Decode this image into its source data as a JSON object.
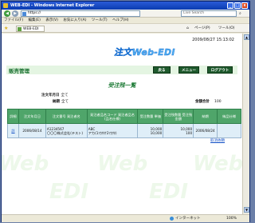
{
  "window": {
    "title": "WEB-EDI - Windows Internet Explorer",
    "minimize": "_",
    "maximize": "□",
    "close": "x"
  },
  "browser": {
    "back": "◀",
    "forward": "▶",
    "address": "https://",
    "search_placeholder": "Live Search",
    "menu": [
      "ファイル(F)",
      "編集(E)",
      "表示(V)",
      "お気に入り(A)",
      "ツール(T)",
      "ヘルプ(H)"
    ],
    "tab_title": "WEB-EDI",
    "toolbar": {
      "home": "⌂",
      "page": "ページ(P)",
      "tools": "ツール(O)"
    },
    "status_zone": "インターネット",
    "zoom": "100%"
  },
  "page": {
    "datetime": "2009/08/27 15:13:02",
    "logo": "注文Web-EDI",
    "watermark": "Web",
    "watermark2": "EDI",
    "system_title": "販売管理",
    "buttons": {
      "back": "戻る",
      "menu": "メニュー",
      "logout": "ログアウト"
    },
    "page_title": "受注残一覧",
    "conditions": {
      "order_date_label": "注文年月日",
      "order_date_value": "全て",
      "delivery_label": "納期",
      "delivery_value": "全て",
      "total_label": "金額合計",
      "total_value": "100"
    },
    "table": {
      "headers": [
        "詳細",
        "注文年月日",
        "注文番号 発注者名",
        "発注者品名コード 発注者品名(品名仕様)",
        "受注数量 単価",
        "受注残数量 受注残金額",
        "納期",
        "納品仕様"
      ],
      "rows": [
        {
          "detail": "詳",
          "order_date": "2006/08/14",
          "order_no": "A1234567",
          "orderer": "〇〇〇株式会社(テスト)",
          "item_code": "ABC",
          "item_name": "アカ(1ｱｶｻﾀﾅ2ｱｶｻﾀ)",
          "qty": "10,000",
          "unit_price": "10,000",
          "remain_qty": "10,000",
          "remain_amount": "100",
          "delivery": "2006/08/24",
          "spec": ""
        }
      ]
    },
    "cancel_link": "取消依頼"
  },
  "colors": {
    "accent": "#1c7a35",
    "table_header": "#4fa56a",
    "logo": "#4fb0f4"
  }
}
